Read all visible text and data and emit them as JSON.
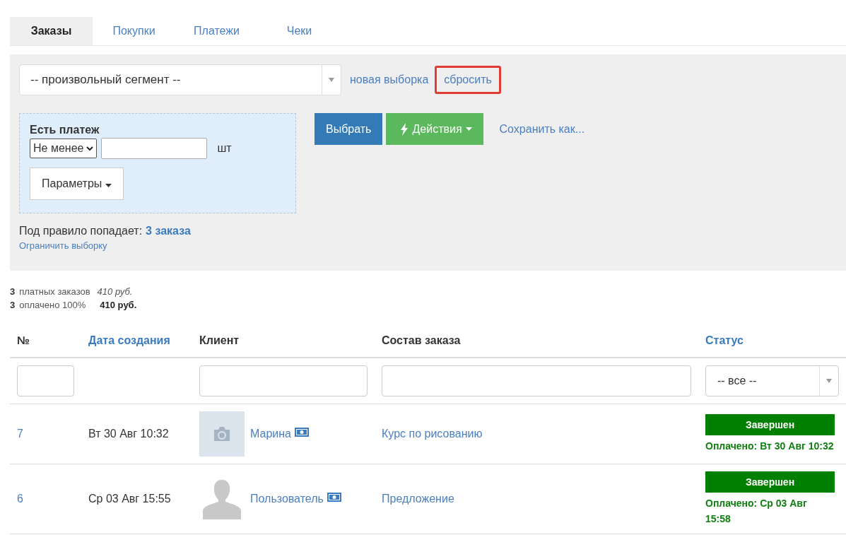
{
  "tabs": [
    {
      "label": "Заказы",
      "selected": true
    },
    {
      "label": "Покупки",
      "selected": false
    },
    {
      "label": "Платежи",
      "selected": false
    },
    {
      "label": "Чеки",
      "selected": false
    }
  ],
  "filter": {
    "segment": "-- произвольный сегмент --",
    "new_link": "новая выборка",
    "reset_link": {
      "label": "сбросить",
      "highlighted": true
    },
    "rule": {
      "title": "Есть платеж",
      "operator": "Не менее",
      "unit": "шт",
      "params_button": "Параметры"
    },
    "select_button": "Выбрать",
    "actions_button": "Действия",
    "save_link": "Сохранить как...",
    "match_label": "Под правило попадает:",
    "match_count": "3 заказа",
    "limit_link": "Ограничить выборку"
  },
  "summary": [
    {
      "count": "3",
      "label": "платных заказов",
      "amount": "410 руб.",
      "kind": "italic"
    },
    {
      "count": "3",
      "label": "оплачено 100%",
      "amount": "410 руб.",
      "kind": "bold"
    }
  ],
  "table": {
    "columns": [
      {
        "label": "№",
        "sortable": false,
        "kind": "input"
      },
      {
        "label": "Дата создания",
        "sortable": true,
        "kind": "none"
      },
      {
        "label": "Клиент",
        "sortable": false,
        "kind": "input"
      },
      {
        "label": "Состав заказа",
        "sortable": false,
        "kind": "input"
      },
      {
        "label": "Статус",
        "sortable": true,
        "kind": "select",
        "filter_value": "-- все --"
      }
    ],
    "rows": [
      {
        "number": "7",
        "date": "Вт 30 Авг 10:32",
        "kind": "camera",
        "client": "Марина",
        "items": "Курс по рисованию",
        "status": "Завершен",
        "paid": "Оплачено: Вт 30 Авг 10:32"
      },
      {
        "number": "6",
        "date": "Ср 03 Авг 15:55",
        "kind": "person",
        "client": "Пользователь",
        "items": "Предложение",
        "status": "Завершен",
        "paid": "Оплачено: Ср 03 Авг 15:58"
      }
    ]
  }
}
